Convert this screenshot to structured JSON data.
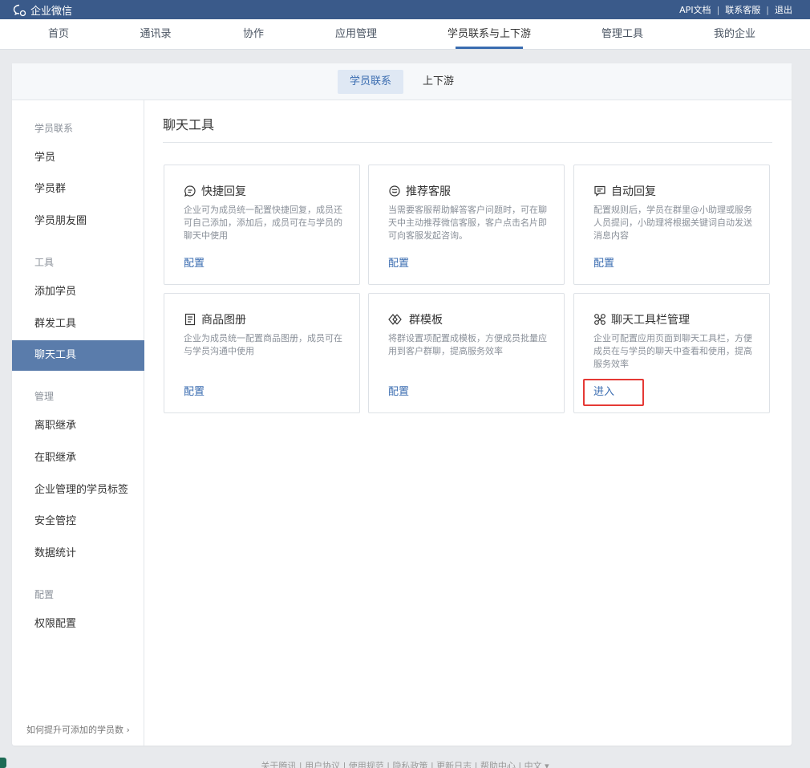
{
  "topbar": {
    "brand": "企业微信",
    "links": [
      "API文档",
      "联系客服",
      "退出"
    ]
  },
  "nav": {
    "items": [
      "首页",
      "通讯录",
      "协作",
      "应用管理",
      "学员联系与上下游",
      "管理工具",
      "我的企业"
    ],
    "active_index": 4
  },
  "subtabs": {
    "active": "学员联系",
    "other": "上下游"
  },
  "sidebar": {
    "groups": [
      {
        "title": "学员联系",
        "items": [
          "学员",
          "学员群",
          "学员朋友圈"
        ]
      },
      {
        "title": "工具",
        "items": [
          "添加学员",
          "群发工具",
          "聊天工具"
        ]
      },
      {
        "title": "管理",
        "items": [
          "离职继承",
          "在职继承",
          "企业管理的学员标签",
          "安全管控",
          "数据统计"
        ]
      },
      {
        "title": "配置",
        "items": [
          "权限配置"
        ]
      }
    ],
    "active_item": "聊天工具",
    "help_link": "如何提升可添加的学员数"
  },
  "main": {
    "title": "聊天工具",
    "cards": [
      {
        "icon": "chat-bubble-icon",
        "title": "快捷回复",
        "desc": "企业可为成员统一配置快捷回复，成员还可自己添加，添加后，成员可在与学员的聊天中使用",
        "action": "配置"
      },
      {
        "icon": "headset-smile-icon",
        "title": "推荐客服",
        "desc": "当需要客服帮助解答客户问题时，可在聊天中主动推荐微信客服，客户点击名片即可向客服发起咨询。",
        "action": "配置"
      },
      {
        "icon": "auto-reply-icon",
        "title": "自动回复",
        "desc": "配置规则后，学员在群里@小助理或服务人员提问，小助理将根据关键词自动发送消息内容",
        "action": "配置"
      },
      {
        "icon": "catalog-icon",
        "title": "商品图册",
        "desc": "企业为成员统一配置商品图册，成员可在与学员沟通中使用",
        "action": "配置"
      },
      {
        "icon": "template-icon",
        "title": "群模板",
        "desc": "将群设置项配置成模板，方便成员批量应用到客户群聊，提高服务效率",
        "action": "配置"
      },
      {
        "icon": "toolbar-manage-icon",
        "title": "聊天工具栏管理",
        "desc": "企业可配置应用页面到聊天工具栏，方便成员在与学员的聊天中查看和使用，提高服务效率",
        "action": "进入"
      }
    ]
  },
  "footer": {
    "text": "关于腾讯 | 用户协议 | 使用规范 | 隐私政策 | 更新日志 | 帮助中心 | 中文 ▾"
  },
  "colors": {
    "topbar": "#3a5a8a",
    "accent": "#3a6cb0",
    "sidebar_active": "#5a7cab",
    "highlight": "#e53935"
  }
}
